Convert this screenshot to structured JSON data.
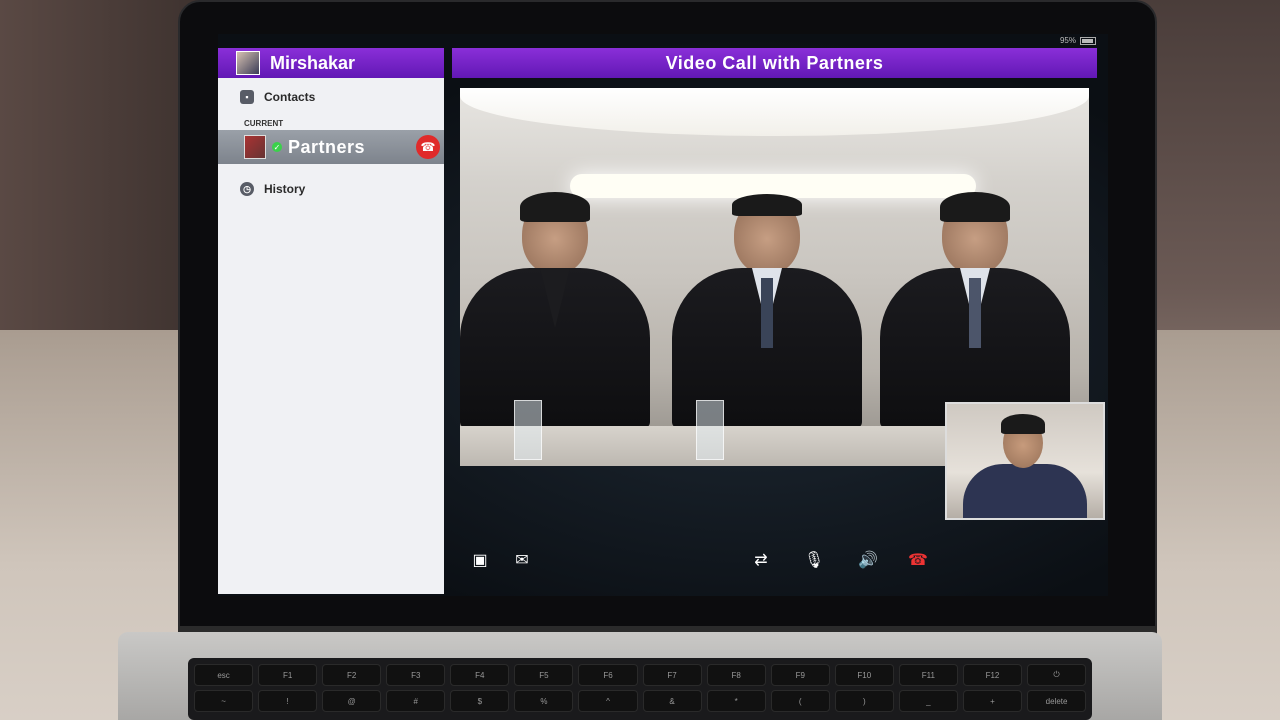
{
  "status_bar": {
    "battery": "95%"
  },
  "sidebar": {
    "user_name": "Mirshakar",
    "contacts_label": "Contacts",
    "section_label": "CURRENT",
    "current_call": "Partners",
    "history_label": "History"
  },
  "main": {
    "title": "Video Call with Partners"
  },
  "keyboard": {
    "row1": [
      "esc",
      "F1",
      "F2",
      "F3",
      "F4",
      "F5",
      "F6",
      "F7",
      "F8",
      "F9",
      "F10",
      "F11",
      "F12",
      "⏻"
    ],
    "row2": [
      "~",
      "!",
      "@",
      "#",
      "$",
      "%",
      "^",
      "&",
      "*",
      "(",
      ")",
      "_",
      "+",
      "delete"
    ]
  },
  "colors": {
    "accent": "#7a24c9",
    "end_call": "#e02a2a",
    "online": "#3bd14b"
  },
  "icons": {
    "contacts": "contacts-icon",
    "history": "clock-icon",
    "share": "screen-share-icon",
    "chat": "chat-icon",
    "camera": "camera-switch-icon",
    "mic": "microphone-icon",
    "speaker": "speaker-icon",
    "hangup": "hangup-icon"
  }
}
